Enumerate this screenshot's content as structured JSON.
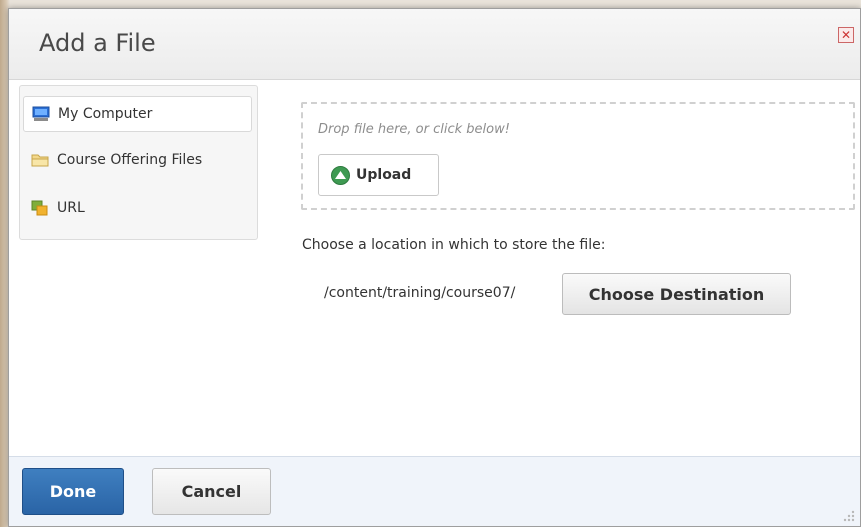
{
  "dialog": {
    "title": "Add a File",
    "close_icon": "close-icon"
  },
  "sidebar": {
    "items": [
      {
        "label": "My Computer",
        "icon": "computer-icon",
        "selected": true
      },
      {
        "label": "Course Offering Files",
        "icon": "folder-icon",
        "selected": false
      },
      {
        "label": "URL",
        "icon": "url-icon",
        "selected": false
      }
    ]
  },
  "upload": {
    "drop_hint": "Drop file here, or click below!",
    "upload_label": "Upload"
  },
  "destination": {
    "prompt": "Choose a location in which to store the file:",
    "path": "/content/training/course07/",
    "choose_label": "Choose Destination"
  },
  "footer": {
    "done_label": "Done",
    "cancel_label": "Cancel"
  },
  "colors": {
    "primary_button": "#2f6daf",
    "upload_icon": "#3e9a52",
    "footer_bg": "#f0f4fa"
  }
}
